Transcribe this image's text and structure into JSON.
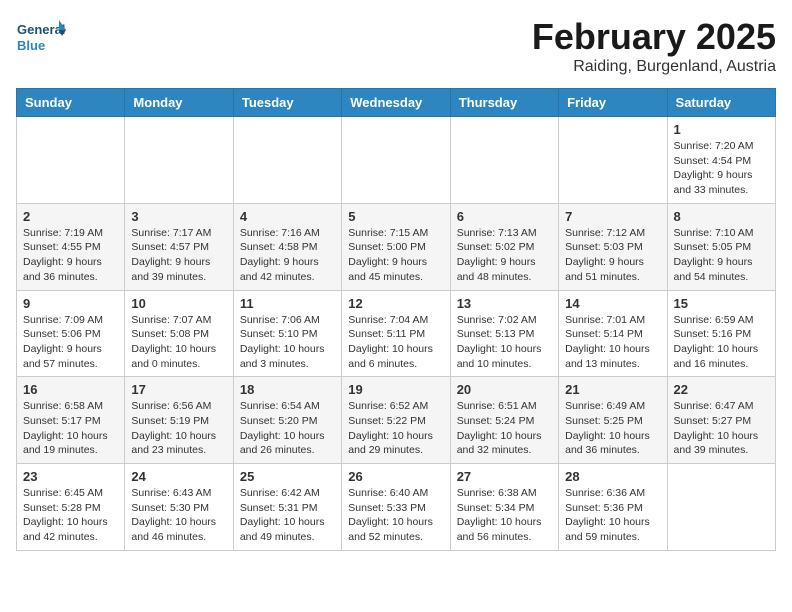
{
  "logo": {
    "general": "General",
    "blue": "Blue"
  },
  "header": {
    "month": "February 2025",
    "location": "Raiding, Burgenland, Austria"
  },
  "weekdays": [
    "Sunday",
    "Monday",
    "Tuesday",
    "Wednesday",
    "Thursday",
    "Friday",
    "Saturday"
  ],
  "weeks": [
    [
      {
        "day": "",
        "info": ""
      },
      {
        "day": "",
        "info": ""
      },
      {
        "day": "",
        "info": ""
      },
      {
        "day": "",
        "info": ""
      },
      {
        "day": "",
        "info": ""
      },
      {
        "day": "",
        "info": ""
      },
      {
        "day": "1",
        "info": "Sunrise: 7:20 AM\nSunset: 4:54 PM\nDaylight: 9 hours and 33 minutes."
      }
    ],
    [
      {
        "day": "2",
        "info": "Sunrise: 7:19 AM\nSunset: 4:55 PM\nDaylight: 9 hours and 36 minutes."
      },
      {
        "day": "3",
        "info": "Sunrise: 7:17 AM\nSunset: 4:57 PM\nDaylight: 9 hours and 39 minutes."
      },
      {
        "day": "4",
        "info": "Sunrise: 7:16 AM\nSunset: 4:58 PM\nDaylight: 9 hours and 42 minutes."
      },
      {
        "day": "5",
        "info": "Sunrise: 7:15 AM\nSunset: 5:00 PM\nDaylight: 9 hours and 45 minutes."
      },
      {
        "day": "6",
        "info": "Sunrise: 7:13 AM\nSunset: 5:02 PM\nDaylight: 9 hours and 48 minutes."
      },
      {
        "day": "7",
        "info": "Sunrise: 7:12 AM\nSunset: 5:03 PM\nDaylight: 9 hours and 51 minutes."
      },
      {
        "day": "8",
        "info": "Sunrise: 7:10 AM\nSunset: 5:05 PM\nDaylight: 9 hours and 54 minutes."
      }
    ],
    [
      {
        "day": "9",
        "info": "Sunrise: 7:09 AM\nSunset: 5:06 PM\nDaylight: 9 hours and 57 minutes."
      },
      {
        "day": "10",
        "info": "Sunrise: 7:07 AM\nSunset: 5:08 PM\nDaylight: 10 hours and 0 minutes."
      },
      {
        "day": "11",
        "info": "Sunrise: 7:06 AM\nSunset: 5:10 PM\nDaylight: 10 hours and 3 minutes."
      },
      {
        "day": "12",
        "info": "Sunrise: 7:04 AM\nSunset: 5:11 PM\nDaylight: 10 hours and 6 minutes."
      },
      {
        "day": "13",
        "info": "Sunrise: 7:02 AM\nSunset: 5:13 PM\nDaylight: 10 hours and 10 minutes."
      },
      {
        "day": "14",
        "info": "Sunrise: 7:01 AM\nSunset: 5:14 PM\nDaylight: 10 hours and 13 minutes."
      },
      {
        "day": "15",
        "info": "Sunrise: 6:59 AM\nSunset: 5:16 PM\nDaylight: 10 hours and 16 minutes."
      }
    ],
    [
      {
        "day": "16",
        "info": "Sunrise: 6:58 AM\nSunset: 5:17 PM\nDaylight: 10 hours and 19 minutes."
      },
      {
        "day": "17",
        "info": "Sunrise: 6:56 AM\nSunset: 5:19 PM\nDaylight: 10 hours and 23 minutes."
      },
      {
        "day": "18",
        "info": "Sunrise: 6:54 AM\nSunset: 5:20 PM\nDaylight: 10 hours and 26 minutes."
      },
      {
        "day": "19",
        "info": "Sunrise: 6:52 AM\nSunset: 5:22 PM\nDaylight: 10 hours and 29 minutes."
      },
      {
        "day": "20",
        "info": "Sunrise: 6:51 AM\nSunset: 5:24 PM\nDaylight: 10 hours and 32 minutes."
      },
      {
        "day": "21",
        "info": "Sunrise: 6:49 AM\nSunset: 5:25 PM\nDaylight: 10 hours and 36 minutes."
      },
      {
        "day": "22",
        "info": "Sunrise: 6:47 AM\nSunset: 5:27 PM\nDaylight: 10 hours and 39 minutes."
      }
    ],
    [
      {
        "day": "23",
        "info": "Sunrise: 6:45 AM\nSunset: 5:28 PM\nDaylight: 10 hours and 42 minutes."
      },
      {
        "day": "24",
        "info": "Sunrise: 6:43 AM\nSunset: 5:30 PM\nDaylight: 10 hours and 46 minutes."
      },
      {
        "day": "25",
        "info": "Sunrise: 6:42 AM\nSunset: 5:31 PM\nDaylight: 10 hours and 49 minutes."
      },
      {
        "day": "26",
        "info": "Sunrise: 6:40 AM\nSunset: 5:33 PM\nDaylight: 10 hours and 52 minutes."
      },
      {
        "day": "27",
        "info": "Sunrise: 6:38 AM\nSunset: 5:34 PM\nDaylight: 10 hours and 56 minutes."
      },
      {
        "day": "28",
        "info": "Sunrise: 6:36 AM\nSunset: 5:36 PM\nDaylight: 10 hours and 59 minutes."
      },
      {
        "day": "",
        "info": ""
      }
    ]
  ]
}
